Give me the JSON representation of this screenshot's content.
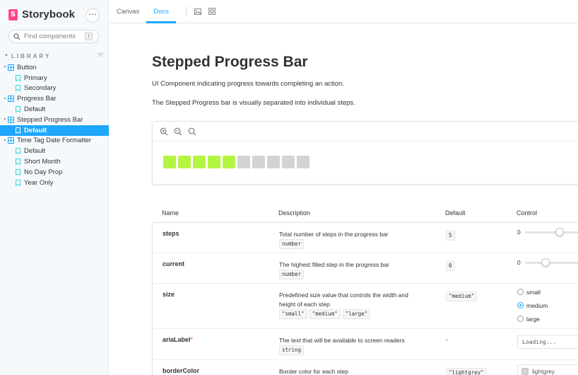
{
  "sidebar": {
    "brand": "Storybook",
    "menu_icon": "ellipsis-icon",
    "search_placeholder": "Find components",
    "search_shortcut": "/",
    "library_label": "LIBRARY",
    "tree": [
      {
        "label": "Button",
        "kind": "component",
        "children": [
          "Primary",
          "Secondary"
        ]
      },
      {
        "label": "Progress Bar",
        "kind": "component",
        "children": [
          "Default"
        ]
      },
      {
        "label": "Stepped Progress Bar",
        "kind": "component",
        "children": [
          "Default"
        ]
      },
      {
        "label": "Time Tag Date Formatter",
        "kind": "component",
        "children": [
          "Default",
          "Short Month",
          "No Day Prop",
          "Year Only"
        ]
      }
    ],
    "selected": "Stepped Progress Bar / Default"
  },
  "toolbar": {
    "tabs": [
      "Canvas",
      "Docs"
    ],
    "active_tab": "Docs"
  },
  "docs": {
    "title": "Stepped Progress Bar",
    "paragraph_1": "UI Component indicating progress towards completing an action.",
    "paragraph_2": "The Stepped Progress bar is visually separated into individual steps.",
    "preview": {
      "steps_total": 10,
      "steps_filled": 5,
      "filled_color": "#b3f542",
      "empty_color": "#d3d3d3"
    },
    "args_headers": {
      "name": "Name",
      "description": "Description",
      "default": "Default",
      "control": "Control"
    },
    "args": {
      "steps": {
        "name": "steps",
        "description": "Total number of steps in the progress bar",
        "type": "number",
        "default": "5",
        "control_value": "0"
      },
      "current": {
        "name": "current",
        "description": "The highest filled step in the progress bar",
        "type": "number",
        "default": "0",
        "control_value": "0"
      },
      "size": {
        "name": "size",
        "description": "Predefined size value that controls the width and height of each step",
        "types": [
          "\"small\"",
          "\"medium\"",
          "\"large\""
        ],
        "default": "\"medium\"",
        "options": [
          "small",
          "medium",
          "large"
        ],
        "selected": "medium"
      },
      "ariaLabel": {
        "name": "ariaLabel",
        "required_mark": "*",
        "description": "The text that will be available to screen readers",
        "type": "string",
        "default": "-",
        "control_value": "Loading..."
      },
      "borderColor": {
        "name": "borderColor",
        "description": "Border color for each step",
        "default": "\"lightgrey\"",
        "control_value": "lightgrey"
      }
    }
  }
}
